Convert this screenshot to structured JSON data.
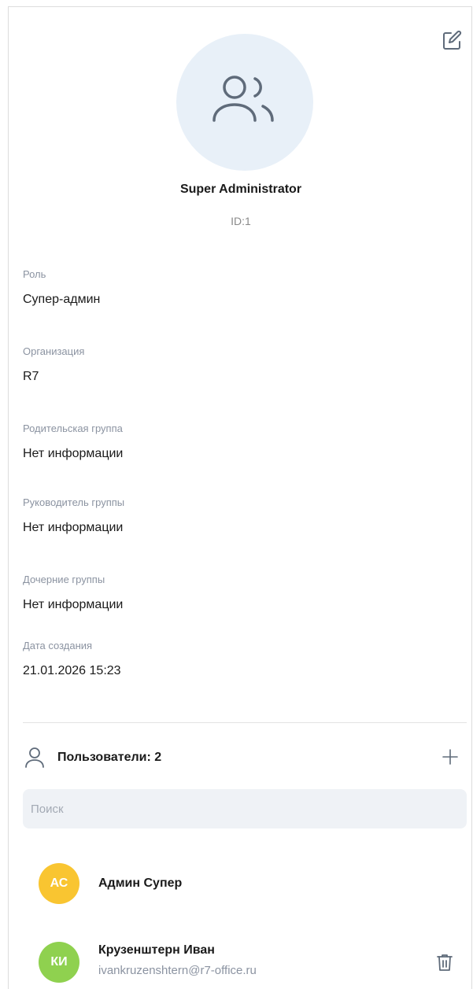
{
  "group": {
    "name": "Super Administrator",
    "id_label": "ID:1"
  },
  "fields": [
    {
      "label": "Роль",
      "value": "Супер-админ"
    },
    {
      "label": "Организация",
      "value": "R7"
    },
    {
      "label": "Родительская группа",
      "value": "Нет информации"
    },
    {
      "label": "Руководитель группы",
      "value": "Нет информации"
    },
    {
      "label": "Дочерние группы",
      "value": "Нет информации"
    },
    {
      "label": "Дата создания",
      "value": "21.01.2026 15:23"
    }
  ],
  "users_section": {
    "title": "Пользователи: 2",
    "search_placeholder": "Поиск"
  },
  "users": [
    {
      "initials": "АС",
      "name": "Админ Супер",
      "email": "",
      "avatar_color": "#f9c531"
    },
    {
      "initials": "КИ",
      "name": "Крузенштерн Иван",
      "email": "ivankruzenshtern@r7-office.ru",
      "avatar_color": "#8fd14f"
    }
  ],
  "colors": {
    "avatar_bg": "#e8f0f8",
    "icon_stroke": "#5f6b7a",
    "label": "#8b93a1"
  },
  "icons": {
    "edit": "edit-icon",
    "group": "group-users-icon",
    "user": "user-icon",
    "add": "plus-icon",
    "delete": "trash-icon"
  }
}
